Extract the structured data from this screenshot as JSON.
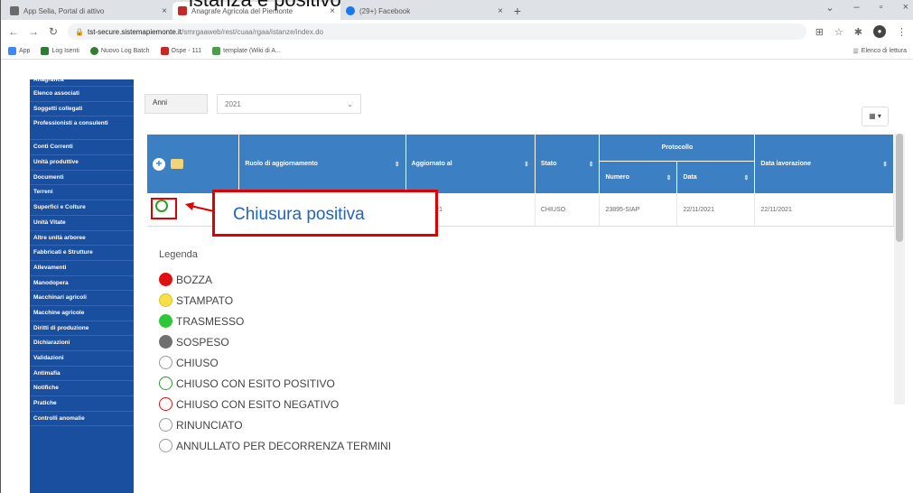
{
  "caption": "istanza è positivo",
  "browser": {
    "tabs": [
      {
        "title": "App Sella, Portal di attivo",
        "fav_color": "#6b6b6b",
        "active": false
      },
      {
        "title": "Anagrafe Agricola del Piemonte",
        "fav_color": "#c62828",
        "active": true
      },
      {
        "title": "(29+) Facebook",
        "fav_color": "#1877f2",
        "active": false
      }
    ],
    "url_domain": "tst-secure.sistemapiemonte.it",
    "url_path": "/smrgaaweb/rest/cuaa/rgaa/istanze/index.do",
    "bookmarks": [
      {
        "label": "App",
        "color": "#4285f4"
      },
      {
        "label": "Log Isenti",
        "color": "#2e7d32"
      },
      {
        "label": "Nuovo Log Batch",
        "color": "#2e7d32"
      },
      {
        "label": "Ospe - 111",
        "color": "#c62828"
      },
      {
        "label": "template (Wiki di A...",
        "color": "#43a047"
      }
    ],
    "reading_list": "Elenco di lettura"
  },
  "sidebar": {
    "items": [
      {
        "label": "Anagrafica",
        "double": false,
        "first": true
      },
      {
        "label": "Elenco associati",
        "double": false
      },
      {
        "label": "Soggetti collegati",
        "double": false
      },
      {
        "label": "Professionisti a consulenti",
        "double": true
      },
      {
        "label": "Conti Correnti",
        "double": false
      },
      {
        "label": "Unità produttive",
        "double": false
      },
      {
        "label": "Documenti",
        "double": false
      },
      {
        "label": "Terreni",
        "double": false
      },
      {
        "label": "Superfici e Colture",
        "double": false
      },
      {
        "label": "Unità Vitate",
        "double": false
      },
      {
        "label": "Altre unità arboree",
        "double": false
      },
      {
        "label": "Fabbricati e Strutture",
        "double": false
      },
      {
        "label": "Allevamenti",
        "double": false
      },
      {
        "label": "Manodopera",
        "double": false
      },
      {
        "label": "Macchinari agricoli",
        "double": false
      },
      {
        "label": "Macchine agricole",
        "double": false
      },
      {
        "label": "Diritti di produzione",
        "double": false
      },
      {
        "label": "Dichiarazioni",
        "double": false
      },
      {
        "label": "Validazioni",
        "double": false
      },
      {
        "label": "Antimafia",
        "double": false
      },
      {
        "label": "Notifiche",
        "double": false
      },
      {
        "label": "Pratiche",
        "double": false
      },
      {
        "label": "Controlli anomalie",
        "double": false
      }
    ]
  },
  "filter": {
    "label": "Anni",
    "value": "2021"
  },
  "grid_button": "▦ ▾",
  "table": {
    "group_header": "Protocollo",
    "headers": [
      "Ruolo di aggiornamento",
      "Aggiornato al",
      "Stato",
      "Numero",
      "Data",
      "Data lavorazione"
    ],
    "row": {
      "ruolo": "",
      "aggiornato": "22/11/2021",
      "stato": "CHIUSO",
      "numero": "23895-SIAP",
      "data": "22/11/2021",
      "lavorazione": "22/11/2021"
    }
  },
  "callout": "Chiusura positiva",
  "legend": {
    "title": "Legenda",
    "items": [
      {
        "label": "BOZZA",
        "fill": "#e01010",
        "border": "#e01010"
      },
      {
        "label": "STAMPATO",
        "fill": "#f7e046",
        "border": "#e0c020"
      },
      {
        "label": "TRASMESSO",
        "fill": "#2ec73a",
        "border": "#2ec73a"
      },
      {
        "label": "SOSPESO",
        "fill": "#707070",
        "border": "#707070"
      },
      {
        "label": "CHIUSO",
        "fill": "#ffffff",
        "border": "#999999"
      },
      {
        "label": "CHIUSO CON ESITO POSITIVO",
        "fill": "#ffffff",
        "border": "#2aa02a"
      },
      {
        "label": "CHIUSO CON ESITO NEGATIVO",
        "fill": "#ffffff",
        "border": "#e01010"
      },
      {
        "label": "RINUNCIATO",
        "fill": "#ffffff",
        "border": "#999999"
      },
      {
        "label": "ANNULLATO PER DECORRENZA TERMINI",
        "fill": "#ffffff",
        "border": "#999999"
      }
    ]
  }
}
